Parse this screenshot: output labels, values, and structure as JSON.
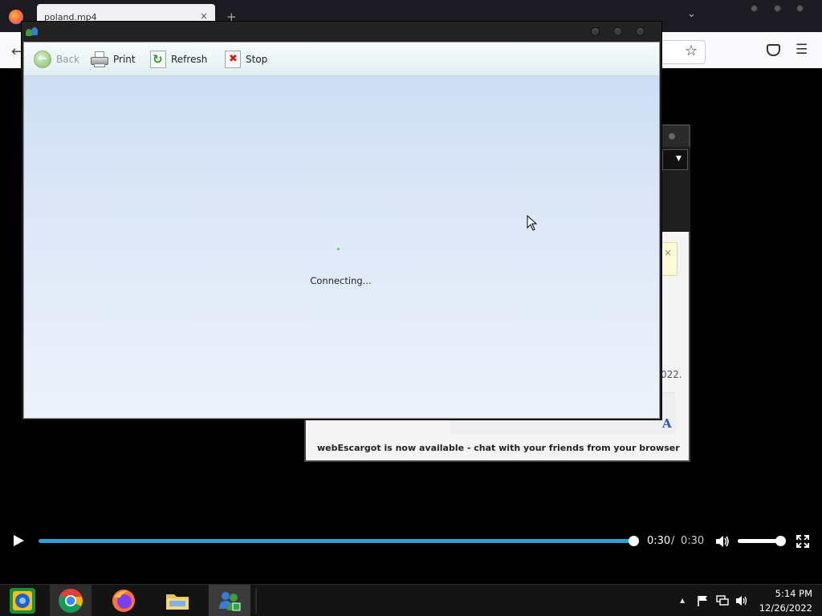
{
  "browser": {
    "tab_title": "poland.mp4",
    "tab_close": "×",
    "new_tab": "+"
  },
  "msn_window": {
    "toolbar": {
      "back_label": "Back",
      "print_label": "Print",
      "refresh_label": "Refresh",
      "stop_label": "Stop"
    },
    "status": "Connecting..."
  },
  "background_window": {
    "date_fragment": "022.",
    "footer_text": "webEscargot is now available - chat with your friends from your browser",
    "font_button": "A"
  },
  "video": {
    "current_time": "0:30",
    "separator": "/",
    "duration": "0:30",
    "progress_fraction": 1.0,
    "volume_fraction": 0.9,
    "accent_color": "#2fa0d8"
  },
  "taskbar": {
    "apps": [
      {
        "name": "start",
        "icon": "start-icon"
      },
      {
        "name": "chrome",
        "icon": "chrome-icon"
      },
      {
        "name": "firefox",
        "icon": "firefox-icon"
      },
      {
        "name": "files",
        "icon": "folder-icon"
      },
      {
        "name": "msn",
        "icon": "msn-icon"
      }
    ],
    "clock": {
      "time": "5:14 PM",
      "date": "12/26/2022"
    }
  }
}
